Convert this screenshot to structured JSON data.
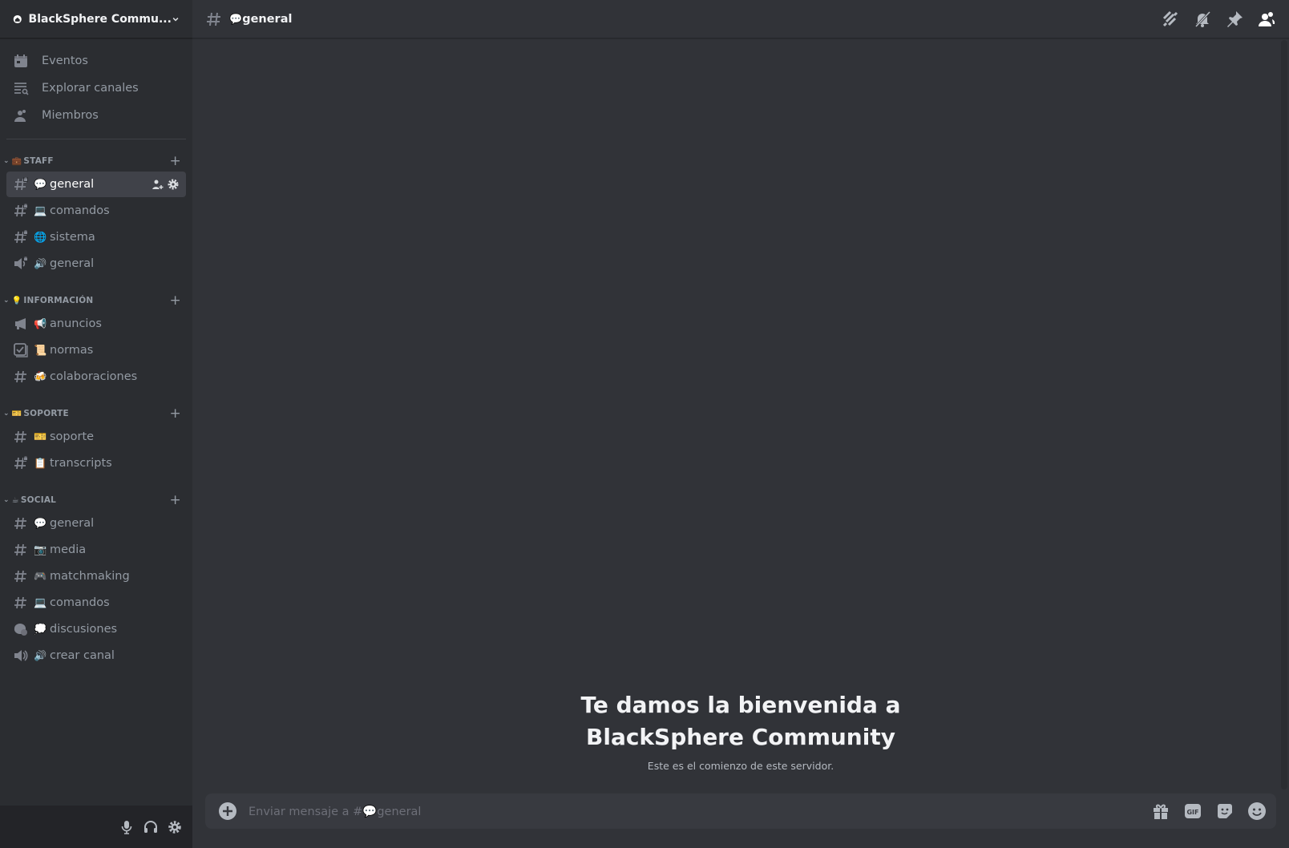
{
  "server": {
    "name": "BlackSphere Commu..."
  },
  "nav": [
    {
      "label": "Eventos",
      "icon": "calendar-icon"
    },
    {
      "label": "Explorar canales",
      "icon": "browse-channels-icon"
    },
    {
      "label": "Miembros",
      "icon": "members-icon"
    }
  ],
  "categories": [
    {
      "name": "STAFF",
      "emoji": "💼",
      "channels": [
        {
          "type": "text-locked",
          "emoji": "💬",
          "name": "general",
          "active": true
        },
        {
          "type": "text-locked",
          "emoji": "💻",
          "name": "comandos"
        },
        {
          "type": "text-locked",
          "emoji": "🌐",
          "name": "sistema"
        },
        {
          "type": "voice-locked",
          "emoji": "🔊",
          "name": "general"
        }
      ]
    },
    {
      "name": "INFORMACIÓN",
      "emoji": "💡",
      "channels": [
        {
          "type": "announcement",
          "emoji": "📢",
          "name": "anuncios"
        },
        {
          "type": "rules",
          "emoji": "📜",
          "name": "normas"
        },
        {
          "type": "text",
          "emoji": "🍻",
          "name": "colaboraciones"
        }
      ]
    },
    {
      "name": "SOPORTE",
      "emoji": "🎫",
      "channels": [
        {
          "type": "text",
          "emoji": "🎫",
          "name": "soporte"
        },
        {
          "type": "text-locked",
          "emoji": "📋",
          "name": "transcripts"
        }
      ]
    },
    {
      "name": "SOCIAL",
      "emoji": "☕",
      "channels": [
        {
          "type": "text",
          "emoji": "💬",
          "name": "general"
        },
        {
          "type": "text",
          "emoji": "📷",
          "name": "media"
        },
        {
          "type": "text",
          "emoji": "🎮",
          "name": "matchmaking"
        },
        {
          "type": "text",
          "emoji": "💻",
          "name": "comandos"
        },
        {
          "type": "forum",
          "emoji": "💭",
          "name": "discusiones"
        },
        {
          "type": "voice",
          "emoji": "🔊",
          "name": "crear canal"
        }
      ]
    }
  ],
  "header": {
    "emoji": "💬",
    "channel": "general",
    "icons": [
      "threads-icon",
      "mute-bell-icon",
      "pin-icon",
      "member-list-icon"
    ]
  },
  "welcome": {
    "line1": "Te damos la bienvenida a",
    "line2": "BlackSphere Community",
    "subtitle": "Este es el comienzo de este servidor."
  },
  "composer": {
    "placeholder": "Enviar mensaje a #💬general",
    "icons": [
      "gift-icon",
      "gif-icon",
      "sticker-icon",
      "emoji-icon"
    ]
  },
  "user_panel": {
    "icons": [
      "microphone-icon",
      "headphones-icon",
      "settings-icon"
    ]
  },
  "colors": {
    "sidebar": "#2b2d31",
    "main": "#313338",
    "active": "#404249",
    "panel": "#232428",
    "input": "#383a40"
  }
}
